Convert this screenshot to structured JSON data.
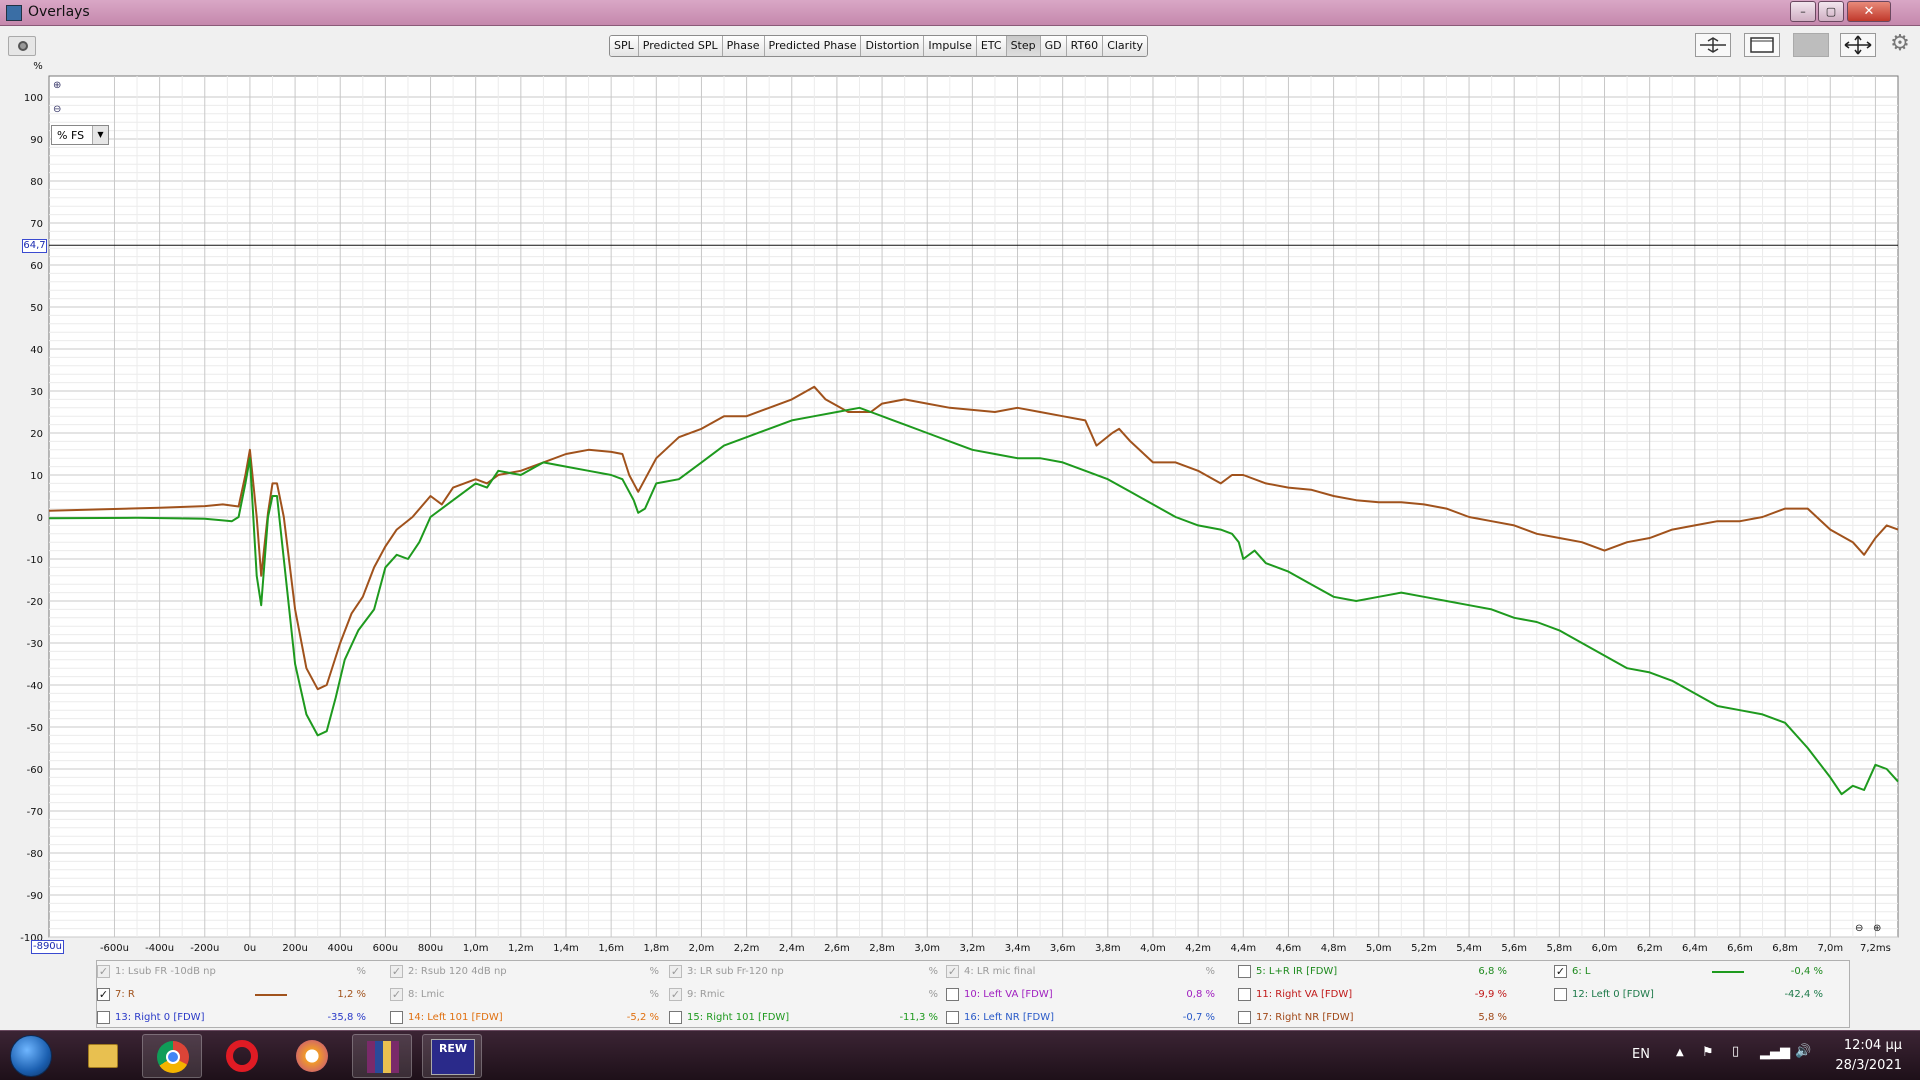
{
  "window": {
    "title": "Overlays",
    "buttons": {
      "minimize": "–",
      "maximize": "▢",
      "close": "✕"
    }
  },
  "tabs": [
    {
      "label": "SPL",
      "active": false
    },
    {
      "label": "Predicted SPL",
      "active": false
    },
    {
      "label": "Phase",
      "active": false
    },
    {
      "label": "Predicted Phase",
      "active": false
    },
    {
      "label": "Distortion",
      "active": false
    },
    {
      "label": "Impulse",
      "active": false
    },
    {
      "label": "ETC",
      "active": false
    },
    {
      "label": "Step",
      "active": true
    },
    {
      "label": "GD",
      "active": false
    },
    {
      "label": "RT60",
      "active": false
    },
    {
      "label": "Clarity",
      "active": false
    }
  ],
  "tool_icons": [
    "align-icon",
    "window-icon",
    "gray-panel-icon",
    "move-arrows-icon",
    "gear-icon"
  ],
  "plot": {
    "y_unit": "%",
    "unit_select": "% FS",
    "cursor_y_label": "64,7",
    "cursor_y": 64.7,
    "cursor_x_label": "-890u",
    "x_unit_suffix": "ms",
    "y_ticks": [
      100,
      90,
      80,
      70,
      60,
      50,
      40,
      30,
      20,
      10,
      0,
      -10,
      -20,
      -30,
      -40,
      -50,
      -60,
      -70,
      -80,
      -90,
      -100
    ],
    "x_ticks": [
      "-600u",
      "-400u",
      "-200u",
      "0u",
      "200u",
      "400u",
      "600u",
      "800u",
      "1,0m",
      "1,2m",
      "1,4m",
      "1,6m",
      "1,8m",
      "2,0m",
      "2,2m",
      "2,4m",
      "2,6m",
      "2,8m",
      "3,0m",
      "3,2m",
      "3,4m",
      "3,6m",
      "3,8m",
      "4,0m",
      "4,2m",
      "4,4m",
      "4,6m",
      "4,8m",
      "5,0m",
      "5,2m",
      "5,4m",
      "5,6m",
      "5,8m",
      "6,0m",
      "6,2m",
      "6,4m",
      "6,6m",
      "6,8m",
      "7,0m",
      "7,2ms"
    ]
  },
  "chart_data": {
    "type": "line",
    "xlabel": "",
    "ylabel": "%",
    "xlim": [
      -0.89,
      7.3
    ],
    "ylim": [
      -100,
      105
    ],
    "x_unit": "ms",
    "grid": true,
    "series": [
      {
        "name": "7: R",
        "color": "#a0521c",
        "points": [
          [
            -0.89,
            1.5
          ],
          [
            -0.4,
            2.2
          ],
          [
            -0.2,
            2.6
          ],
          [
            -0.12,
            3
          ],
          [
            -0.05,
            2.5
          ],
          [
            -0.02,
            10
          ],
          [
            0.0,
            16
          ],
          [
            0.03,
            0
          ],
          [
            0.05,
            -14
          ],
          [
            0.08,
            1
          ],
          [
            0.1,
            8
          ],
          [
            0.12,
            8
          ],
          [
            0.15,
            0
          ],
          [
            0.2,
            -22
          ],
          [
            0.25,
            -36
          ],
          [
            0.3,
            -41
          ],
          [
            0.34,
            -40
          ],
          [
            0.4,
            -30
          ],
          [
            0.45,
            -23
          ],
          [
            0.5,
            -19
          ],
          [
            0.55,
            -12
          ],
          [
            0.6,
            -7
          ],
          [
            0.65,
            -3
          ],
          [
            0.72,
            0
          ],
          [
            0.8,
            5
          ],
          [
            0.85,
            3
          ],
          [
            0.9,
            7
          ],
          [
            1.0,
            9
          ],
          [
            1.05,
            8
          ],
          [
            1.1,
            10
          ],
          [
            1.2,
            11
          ],
          [
            1.3,
            13
          ],
          [
            1.4,
            15
          ],
          [
            1.5,
            16
          ],
          [
            1.6,
            15.5
          ],
          [
            1.65,
            15
          ],
          [
            1.68,
            10
          ],
          [
            1.72,
            6
          ],
          [
            1.75,
            9
          ],
          [
            1.8,
            14
          ],
          [
            1.9,
            19
          ],
          [
            2.0,
            21
          ],
          [
            2.1,
            24
          ],
          [
            2.2,
            24
          ],
          [
            2.3,
            26
          ],
          [
            2.4,
            28
          ],
          [
            2.5,
            31
          ],
          [
            2.55,
            28
          ],
          [
            2.65,
            25
          ],
          [
            2.75,
            25
          ],
          [
            2.8,
            27
          ],
          [
            2.9,
            28
          ],
          [
            3.0,
            27
          ],
          [
            3.1,
            26
          ],
          [
            3.2,
            25.5
          ],
          [
            3.3,
            25
          ],
          [
            3.4,
            26
          ],
          [
            3.5,
            25
          ],
          [
            3.6,
            24
          ],
          [
            3.7,
            23
          ],
          [
            3.75,
            17
          ],
          [
            3.82,
            20
          ],
          [
            3.85,
            21
          ],
          [
            3.9,
            18
          ],
          [
            4.0,
            13
          ],
          [
            4.1,
            13
          ],
          [
            4.2,
            11
          ],
          [
            4.3,
            8
          ],
          [
            4.35,
            10
          ],
          [
            4.4,
            10
          ],
          [
            4.5,
            8
          ],
          [
            4.6,
            7
          ],
          [
            4.7,
            6.5
          ],
          [
            4.8,
            5
          ],
          [
            4.9,
            4
          ],
          [
            5.0,
            3.5
          ],
          [
            5.1,
            3.5
          ],
          [
            5.2,
            3
          ],
          [
            5.3,
            2
          ],
          [
            5.4,
            0
          ],
          [
            5.5,
            -1
          ],
          [
            5.6,
            -2
          ],
          [
            5.7,
            -4
          ],
          [
            5.8,
            -5
          ],
          [
            5.9,
            -6
          ],
          [
            6.0,
            -8
          ],
          [
            6.1,
            -6
          ],
          [
            6.2,
            -5
          ],
          [
            6.3,
            -3
          ],
          [
            6.4,
            -2
          ],
          [
            6.5,
            -1
          ],
          [
            6.6,
            -1
          ],
          [
            6.7,
            0
          ],
          [
            6.8,
            2
          ],
          [
            6.9,
            2
          ],
          [
            7.0,
            -3
          ],
          [
            7.1,
            -6
          ],
          [
            7.15,
            -9
          ],
          [
            7.2,
            -5
          ],
          [
            7.25,
            -2
          ],
          [
            7.3,
            -3
          ]
        ]
      },
      {
        "name": "6: L",
        "color": "#1e9a1e",
        "points": [
          [
            -0.89,
            -0.3
          ],
          [
            -0.5,
            -0.2
          ],
          [
            -0.2,
            -0.4
          ],
          [
            -0.12,
            -0.8
          ],
          [
            -0.08,
            -1
          ],
          [
            -0.05,
            0
          ],
          [
            -0.02,
            8
          ],
          [
            0.0,
            14
          ],
          [
            0.03,
            -14
          ],
          [
            0.05,
            -21
          ],
          [
            0.08,
            0
          ],
          [
            0.1,
            5
          ],
          [
            0.12,
            5
          ],
          [
            0.15,
            -10
          ],
          [
            0.2,
            -35
          ],
          [
            0.25,
            -47
          ],
          [
            0.3,
            -52
          ],
          [
            0.34,
            -51
          ],
          [
            0.38,
            -43
          ],
          [
            0.42,
            -34
          ],
          [
            0.48,
            -27
          ],
          [
            0.55,
            -22
          ],
          [
            0.6,
            -12
          ],
          [
            0.65,
            -9
          ],
          [
            0.7,
            -10
          ],
          [
            0.75,
            -6
          ],
          [
            0.8,
            0
          ],
          [
            0.9,
            4
          ],
          [
            1.0,
            8
          ],
          [
            1.05,
            7
          ],
          [
            1.1,
            11
          ],
          [
            1.2,
            10
          ],
          [
            1.3,
            13
          ],
          [
            1.4,
            12
          ],
          [
            1.5,
            11
          ],
          [
            1.6,
            10
          ],
          [
            1.65,
            9
          ],
          [
            1.7,
            4
          ],
          [
            1.72,
            1
          ],
          [
            1.75,
            2
          ],
          [
            1.8,
            8
          ],
          [
            1.9,
            9
          ],
          [
            2.0,
            13
          ],
          [
            2.1,
            17
          ],
          [
            2.2,
            19
          ],
          [
            2.3,
            21
          ],
          [
            2.4,
            23
          ],
          [
            2.5,
            24
          ],
          [
            2.6,
            25
          ],
          [
            2.7,
            26
          ],
          [
            2.75,
            25
          ],
          [
            2.8,
            24
          ],
          [
            2.9,
            22
          ],
          [
            3.0,
            20
          ],
          [
            3.1,
            18
          ],
          [
            3.2,
            16
          ],
          [
            3.3,
            15
          ],
          [
            3.4,
            14
          ],
          [
            3.5,
            14
          ],
          [
            3.6,
            13
          ],
          [
            3.7,
            11
          ],
          [
            3.8,
            9
          ],
          [
            3.9,
            6
          ],
          [
            4.0,
            3
          ],
          [
            4.1,
            0
          ],
          [
            4.2,
            -2
          ],
          [
            4.3,
            -3
          ],
          [
            4.35,
            -4
          ],
          [
            4.38,
            -6
          ],
          [
            4.4,
            -10
          ],
          [
            4.45,
            -8
          ],
          [
            4.5,
            -11
          ],
          [
            4.6,
            -13
          ],
          [
            4.7,
            -16
          ],
          [
            4.8,
            -19
          ],
          [
            4.9,
            -20
          ],
          [
            5.0,
            -19
          ],
          [
            5.1,
            -18
          ],
          [
            5.2,
            -19
          ],
          [
            5.3,
            -20
          ],
          [
            5.4,
            -21
          ],
          [
            5.5,
            -22
          ],
          [
            5.6,
            -24
          ],
          [
            5.7,
            -25
          ],
          [
            5.8,
            -27
          ],
          [
            5.9,
            -30
          ],
          [
            6.0,
            -33
          ],
          [
            6.1,
            -36
          ],
          [
            6.2,
            -37
          ],
          [
            6.3,
            -39
          ],
          [
            6.4,
            -42
          ],
          [
            6.5,
            -45
          ],
          [
            6.6,
            -46
          ],
          [
            6.7,
            -47
          ],
          [
            6.8,
            -49
          ],
          [
            6.9,
            -55
          ],
          [
            7.0,
            -62
          ],
          [
            7.05,
            -66
          ],
          [
            7.1,
            -64
          ],
          [
            7.15,
            -65
          ],
          [
            7.2,
            -59
          ],
          [
            7.25,
            -60
          ],
          [
            7.3,
            -63
          ]
        ]
      }
    ]
  },
  "legend": [
    {
      "label": "1: Lsub FR -10dB np",
      "value": "%",
      "checked": true,
      "disabled": true,
      "color": "#9a9a9a"
    },
    {
      "label": "2: Rsub 120 4dB np",
      "value": "%",
      "checked": true,
      "disabled": true,
      "color": "#9a9a9a"
    },
    {
      "label": "3: LR sub Fr-120 np",
      "value": "%",
      "checked": true,
      "disabled": true,
      "color": "#9a9a9a"
    },
    {
      "label": "4: LR mic final",
      "value": "%",
      "checked": true,
      "disabled": true,
      "color": "#9a9a9a"
    },
    {
      "label": "5: L+R IR [FDW]",
      "value": "6,8 %",
      "checked": false,
      "disabled": false,
      "color": "#1e8a1e"
    },
    {
      "label": "6: L",
      "value": "-0,4 %",
      "checked": true,
      "disabled": false,
      "color": "#1e8a1e",
      "swatch": "#1e9a1e"
    },
    {
      "label": "7: R",
      "value": "1,2 %",
      "checked": true,
      "disabled": false,
      "color": "#a0521c",
      "swatch": "#a0521c"
    },
    {
      "label": "8: Lmic",
      "value": "%",
      "checked": true,
      "disabled": true,
      "color": "#9a9a9a"
    },
    {
      "label": "9: Rmic",
      "value": "%",
      "checked": true,
      "disabled": true,
      "color": "#9a9a9a"
    },
    {
      "label": "10: Left VA [FDW]",
      "value": "0,8 %",
      "checked": false,
      "disabled": false,
      "color": "#a020c0"
    },
    {
      "label": "11: Right VA [FDW]",
      "value": "-9,9 %",
      "checked": false,
      "disabled": false,
      "color": "#c01818"
    },
    {
      "label": "12: Left 0 [FDW]",
      "value": "-42,4 %",
      "checked": false,
      "disabled": false,
      "color": "#1e7a4a"
    },
    {
      "label": "13: Right 0 [FDW]",
      "value": "-35,8 %",
      "checked": false,
      "disabled": false,
      "color": "#2a3ac8"
    },
    {
      "label": "14: Left 101 [FDW]",
      "value": "-5,2 %",
      "checked": false,
      "disabled": false,
      "color": "#e07010"
    },
    {
      "label": "15: Right  101 [FDW]",
      "value": "-11,3 %",
      "checked": false,
      "disabled": false,
      "color": "#1e9a1e"
    },
    {
      "label": "16: Left NR [FDW]",
      "value": "-0,7 %",
      "checked": false,
      "disabled": false,
      "color": "#2a5ac8"
    },
    {
      "label": "17: Right NR [FDW]",
      "value": "5,8 %",
      "checked": false,
      "disabled": false,
      "color": "#a04818"
    }
  ],
  "taskbar": {
    "apps": [
      "explorer-icon",
      "chrome-icon",
      "opera-icon",
      "firefox-like-icon",
      "winrar-icon",
      "rew-icon"
    ],
    "rew_label": "REW",
    "lang": "EN",
    "time": "12:04 μμ",
    "date": "28/3/2021"
  }
}
